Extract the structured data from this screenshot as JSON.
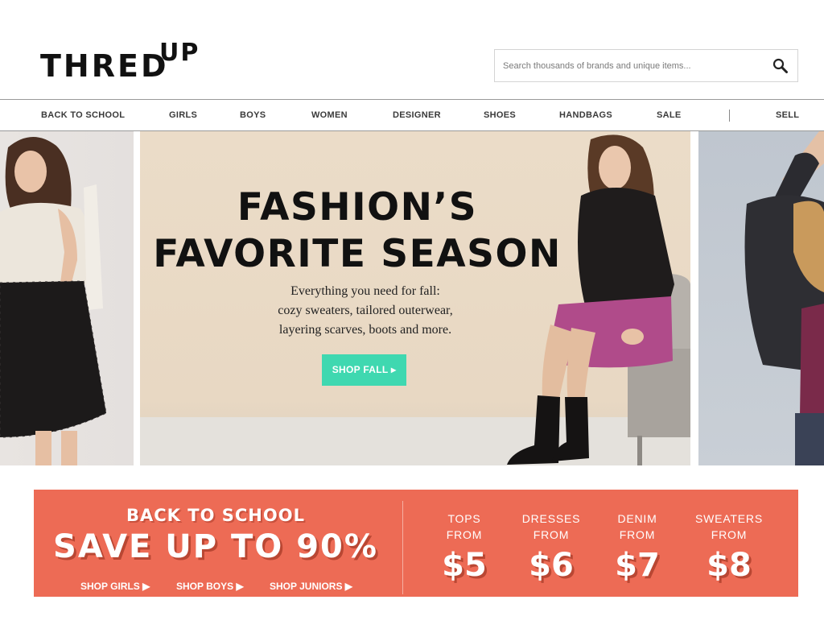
{
  "header": {
    "logo_main": "THRED",
    "logo_sup": "UP",
    "search": {
      "placeholder": "Search thousands of brands and unique items...",
      "icon": "magnifier-icon"
    }
  },
  "nav": {
    "items": [
      {
        "label": "BACK TO SCHOOL"
      },
      {
        "label": "GIRLS"
      },
      {
        "label": "BOYS"
      },
      {
        "label": "WOMEN"
      },
      {
        "label": "DESIGNER"
      },
      {
        "label": "SHOES"
      },
      {
        "label": "HANDBAGS"
      },
      {
        "label": "SALE"
      },
      {
        "label": "SELL"
      }
    ]
  },
  "hero": {
    "title_line1": "FASHION’S",
    "title_line2": "FAVORITE SEASON",
    "subtitle_line1": "Everything you need for fall:",
    "subtitle_line2": "cozy sweaters, tailored outerwear,",
    "subtitle_line3": "layering scarves, boots and more.",
    "cta": "SHOP FALL ▸"
  },
  "promo": {
    "kicker": "BACK TO SCHOOL",
    "headline": "SAVE UP TO 90%",
    "links": [
      {
        "label": "SHOP GIRLS ▶"
      },
      {
        "label": "SHOP BOYS ▶"
      },
      {
        "label": "SHOP JUNIORS ▶"
      }
    ],
    "categories": [
      {
        "name": "TOPS",
        "from": "FROM",
        "price": "$5"
      },
      {
        "name": "DRESSES",
        "from": "FROM",
        "price": "$6"
      },
      {
        "name": "DENIM",
        "from": "FROM",
        "price": "$7"
      },
      {
        "name": "SWEATERS",
        "from": "FROM",
        "price": "$8"
      }
    ]
  },
  "colors": {
    "cta": "#3fd8b0",
    "promo_bg": "#ed6b55",
    "text_dark": "#111111"
  }
}
